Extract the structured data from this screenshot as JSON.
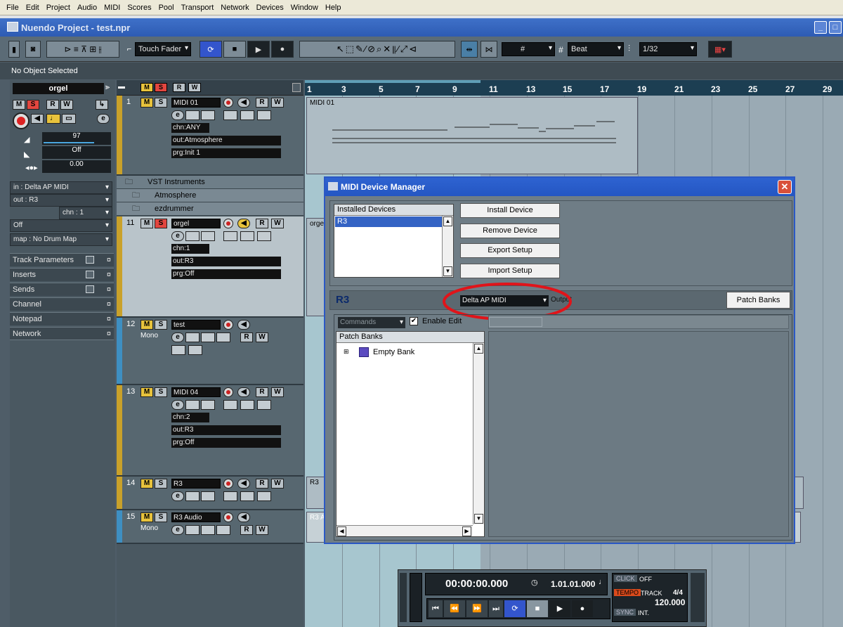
{
  "menubar": [
    "File",
    "Edit",
    "Project",
    "Audio",
    "MIDI",
    "Scores",
    "Pool",
    "Transport",
    "Network",
    "Devices",
    "Window",
    "Help"
  ],
  "window": {
    "title": "Nuendo Project - test.npr"
  },
  "toolbar": {
    "automation_mode": "Touch Fader",
    "grid_type": "Beat",
    "quantize": "1/32",
    "grid_symbol": "#"
  },
  "info_line": "No Object Selected",
  "inspector": {
    "track_name": "orgel",
    "volume": "97",
    "pan": "Off",
    "delay": "0.00",
    "input": "in : Delta AP MIDI",
    "output": "out : R3",
    "channel": "chn : 1",
    "bank": "Off",
    "map": "map : No Drum Map",
    "sections": [
      "Track Parameters",
      "Inserts",
      "Sends",
      "Channel",
      "Notepad",
      "Network"
    ]
  },
  "tracks": [
    {
      "num": "1",
      "name": "MIDI 01",
      "chn": "chn:ANY",
      "out": "out:Atmosphere",
      "prg": "prg:Init 1"
    },
    {
      "num": "11",
      "name": "orgel",
      "chn": "chn:1",
      "out": "out:R3",
      "prg": "prg:Off"
    },
    {
      "num": "12",
      "name": "test",
      "sub": "Mono"
    },
    {
      "num": "13",
      "name": "MIDI 04",
      "chn": "chn:2",
      "out": "out:R3",
      "prg": "prg:Off"
    },
    {
      "num": "14",
      "name": "R3"
    },
    {
      "num": "15",
      "name": "R3 Audio",
      "sub": "Mono"
    }
  ],
  "folders": [
    "VST Instruments",
    "Atmosphere",
    "ezdrummer"
  ],
  "ruler": [
    "1",
    "3",
    "5",
    "7",
    "9",
    "11",
    "13",
    "15",
    "17",
    "19",
    "21",
    "23",
    "25",
    "27",
    "29"
  ],
  "parts": {
    "midi01": "MIDI 01",
    "orgel": "orge",
    "r3": "R3",
    "r3audio": "R3 A"
  },
  "dialog": {
    "title": "MIDI Device Manager",
    "installed_header": "Installed Devices",
    "installed_devices": [
      "R3"
    ],
    "buttons": {
      "install": "Install Device",
      "remove": "Remove Device",
      "export": "Export Setup",
      "import": "Import Setup",
      "patch_banks": "Patch Banks"
    },
    "device_name": "R3",
    "output_select": "Delta AP MIDI",
    "output_label": "Output",
    "commands": "Commands",
    "enable_edit": "Enable Edit",
    "patch_banks_header": "Patch Banks",
    "bank_item": "Empty Bank"
  },
  "transport": {
    "time": "00:00:00.000",
    "bars": "1.01.01.000",
    "click": "CLICK",
    "click_state": "OFF",
    "tempo": "TEMPO",
    "track": "TRACK",
    "signature": "4/4",
    "bpm": "120.000",
    "sync": "SYNC",
    "sync_state": "INT."
  },
  "colors": {
    "highlight_ellipse": "#e0141a",
    "title_blue": "#2456c2",
    "ruler": "#1c3e52"
  }
}
